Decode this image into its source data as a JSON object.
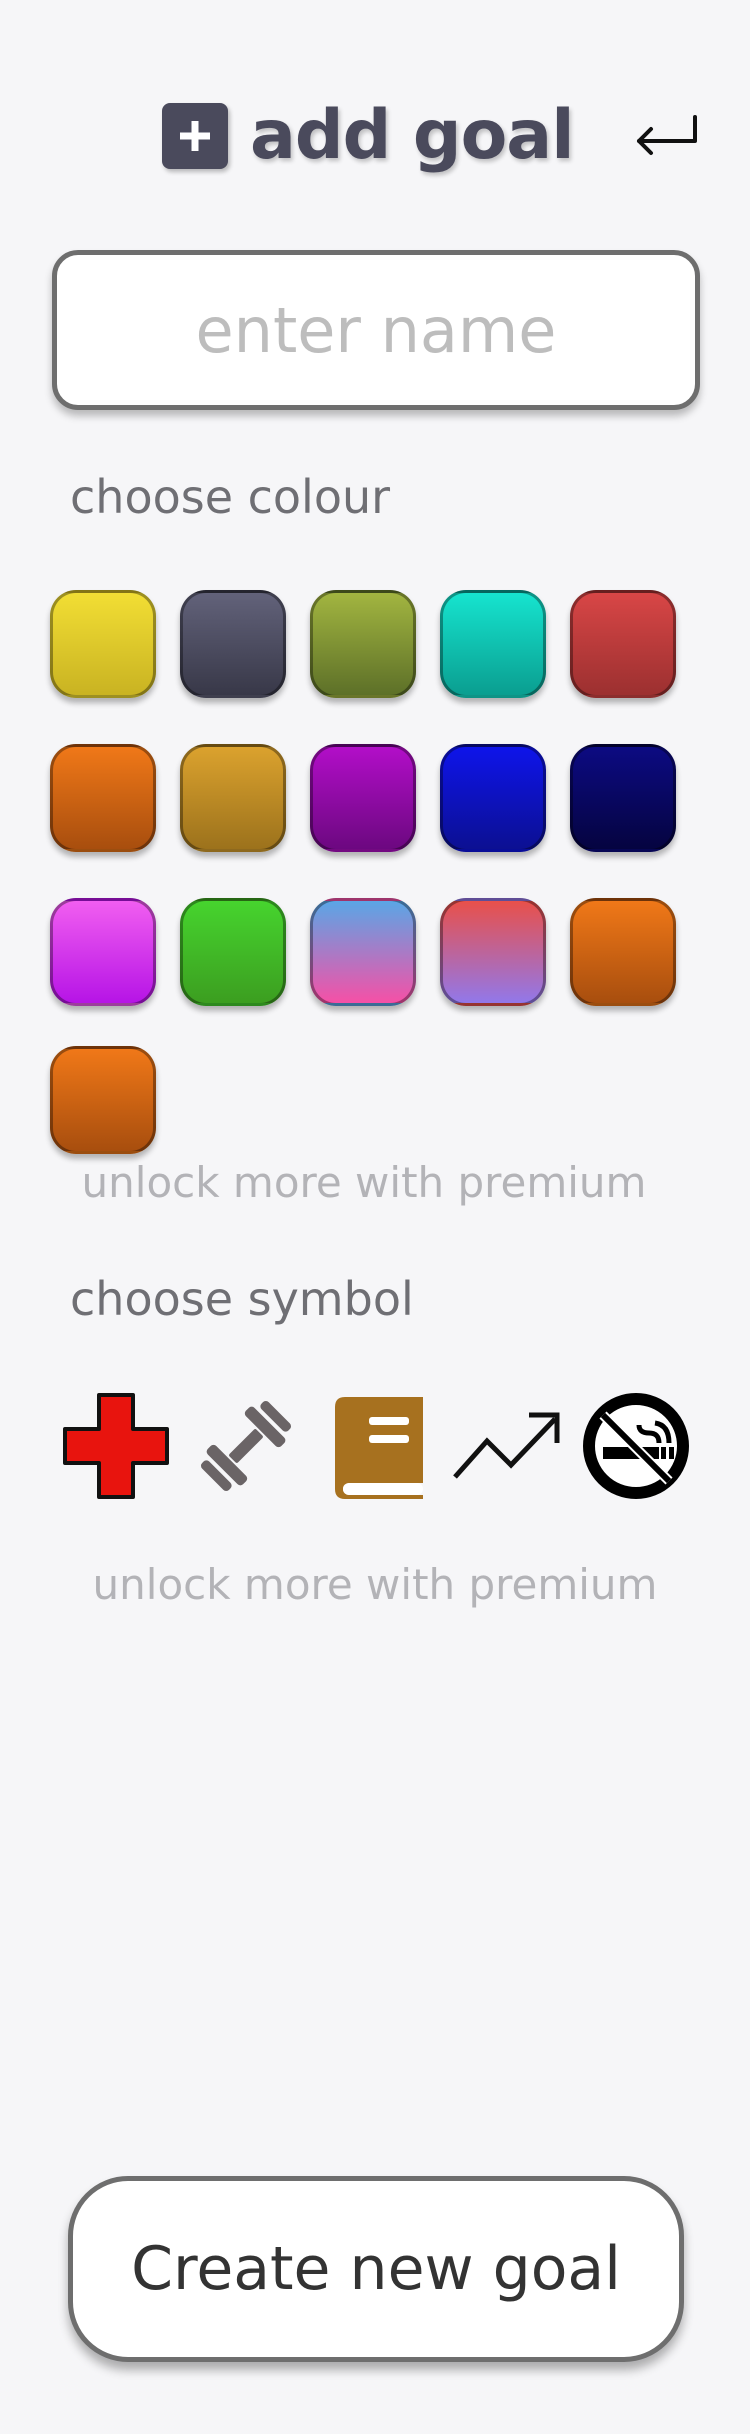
{
  "header": {
    "title": "add goal",
    "plus_icon": "plus-square-icon",
    "back_icon": "return-arrow-icon"
  },
  "name_input": {
    "placeholder": "enter name",
    "value": ""
  },
  "colour_section": {
    "label": "choose colour",
    "premium_note": "unlock more with premium",
    "swatches": [
      {
        "id": "yellow",
        "top": "#f2de34",
        "bottom": "#c9b322"
      },
      {
        "id": "slate",
        "top": "#62627a",
        "bottom": "#383848"
      },
      {
        "id": "olive",
        "top": "#a2b540",
        "bottom": "#5d7028"
      },
      {
        "id": "teal",
        "top": "#16e4cf",
        "bottom": "#0a9e90"
      },
      {
        "id": "red",
        "top": "#d84646",
        "bottom": "#9c3030"
      },
      {
        "id": "orange",
        "top": "#f07818",
        "bottom": "#a84e0e"
      },
      {
        "id": "gold",
        "top": "#dba22e",
        "bottom": "#9c721c"
      },
      {
        "id": "purple",
        "top": "#b20ec8",
        "bottom": "#6c0880"
      },
      {
        "id": "blue",
        "top": "#0e14ea",
        "bottom": "#0c1092"
      },
      {
        "id": "navy",
        "top": "#0c0a82",
        "bottom": "#050440"
      },
      {
        "id": "magenta",
        "top": "#f15ef0",
        "bottom": "#b614e6"
      },
      {
        "id": "green",
        "top": "#46d42e",
        "bottom": "#3c9e20"
      },
      {
        "id": "blue-pink-gradient",
        "top": "#5aa6e6",
        "bottom": "#f650a6"
      },
      {
        "id": "red-violet-gradient",
        "top": "#e8504a",
        "bottom": "#9278ea"
      },
      {
        "id": "orange-2",
        "top": "#f07818",
        "bottom": "#a84e0e"
      },
      {
        "id": "orange-3",
        "top": "#f07818",
        "bottom": "#a84e0e"
      }
    ]
  },
  "symbol_section": {
    "label": "choose symbol",
    "premium_note": "unlock more with premium",
    "symbols": [
      {
        "id": "health-cross",
        "icon": "red-cross-icon",
        "color": "#e8140e"
      },
      {
        "id": "dumbbell",
        "icon": "dumbbell-icon",
        "color": "#6a6466"
      },
      {
        "id": "book",
        "icon": "book-icon",
        "color": "#a7711f"
      },
      {
        "id": "trend-up",
        "icon": "trend-up-icon",
        "color": "#111111"
      },
      {
        "id": "no-smoking",
        "icon": "no-smoking-icon",
        "color": "#000000"
      }
    ]
  },
  "create_button": {
    "label": "Create new goal"
  }
}
